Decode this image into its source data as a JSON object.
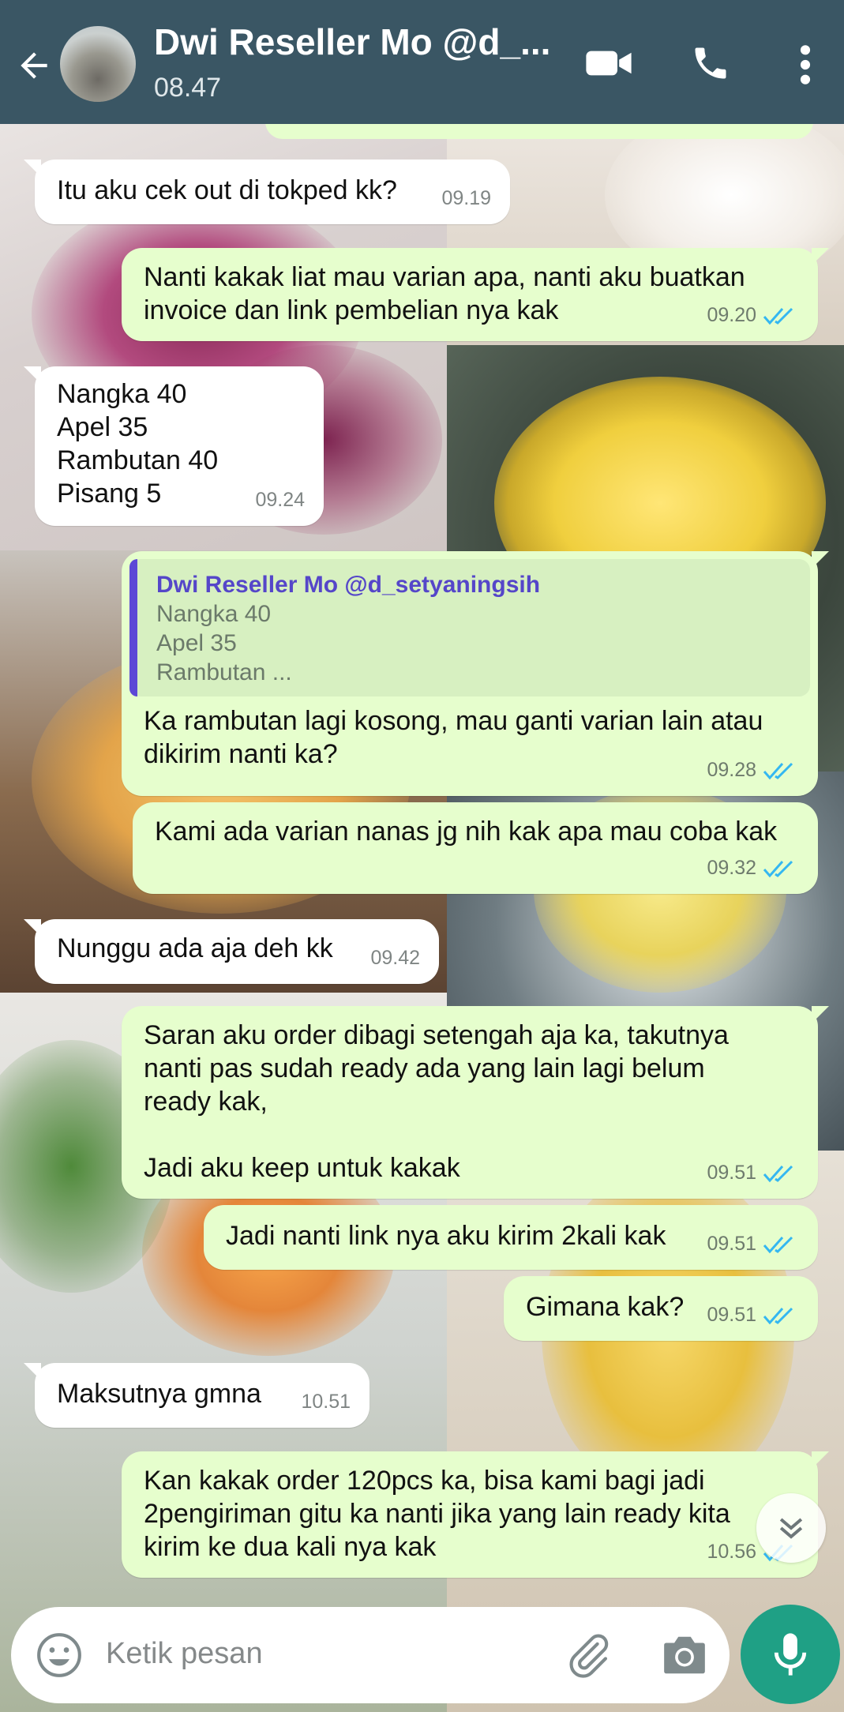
{
  "header": {
    "contact_name": "Dwi Reseller Mo @d_...",
    "status_time": "08.47",
    "bg_color": "#3a5664"
  },
  "messages": [
    {
      "dir": "in",
      "text": "Itu aku cek out di tokped kk?",
      "time": "09.19"
    },
    {
      "dir": "out",
      "text": "Nanti kakak liat mau varian apa, nanti aku buatkan\ninvoice dan link pembelian nya kak",
      "time": "09.20",
      "read": true
    },
    {
      "dir": "in",
      "text": "Nangka 40\nApel 35\nRambutan 40\nPisang 5",
      "time": "09.24"
    },
    {
      "dir": "out",
      "quote": {
        "name": "Dwi Reseller Mo @d_setyaningsih",
        "text": "Nangka 40\nApel 35\nRambutan ..."
      },
      "text": "Ka rambutan lagi kosong, mau ganti varian lain atau\ndikirim nanti ka?",
      "time": "09.28",
      "read": true
    },
    {
      "dir": "out",
      "text": "Kami ada varian nanas jg nih kak apa mau coba kak",
      "time": "09.32",
      "read": true
    },
    {
      "dir": "in",
      "text": "Nunggu ada aja deh kk",
      "time": "09.42"
    },
    {
      "dir": "out",
      "text": "Saran aku order dibagi setengah aja ka, takutnya\nnanti pas sudah ready ada yang lain lagi belum\nready kak,\n\nJadi aku keep untuk kakak",
      "time": "09.51",
      "read": true
    },
    {
      "dir": "out",
      "text": "Jadi nanti link nya aku kirim 2kali kak",
      "time": "09.51",
      "read": true
    },
    {
      "dir": "out",
      "text": "Gimana kak?",
      "time": "09.51",
      "read": true
    },
    {
      "dir": "in",
      "text": "Maksutnya gmna",
      "time": "10.51"
    },
    {
      "dir": "out",
      "text": "Kan kakak order 120pcs ka, bisa kami bagi jadi\n2pengiriman gitu ka nanti jika yang lain ready kita\nkirim ke dua kali nya kak",
      "time": "10.56",
      "read": true
    }
  ],
  "input": {
    "placeholder": "Ketik pesan"
  },
  "colors": {
    "outgoing_bubble": "#e6fecd",
    "incoming_bubble": "#ffffff",
    "read_tick": "#34b7f1",
    "mic_button": "#1fa085"
  },
  "icons": [
    "back-arrow-icon",
    "video-call-icon",
    "phone-icon",
    "more-vert-icon",
    "emoji-icon",
    "attach-icon",
    "camera-icon",
    "mic-icon",
    "scroll-down-icon"
  ]
}
